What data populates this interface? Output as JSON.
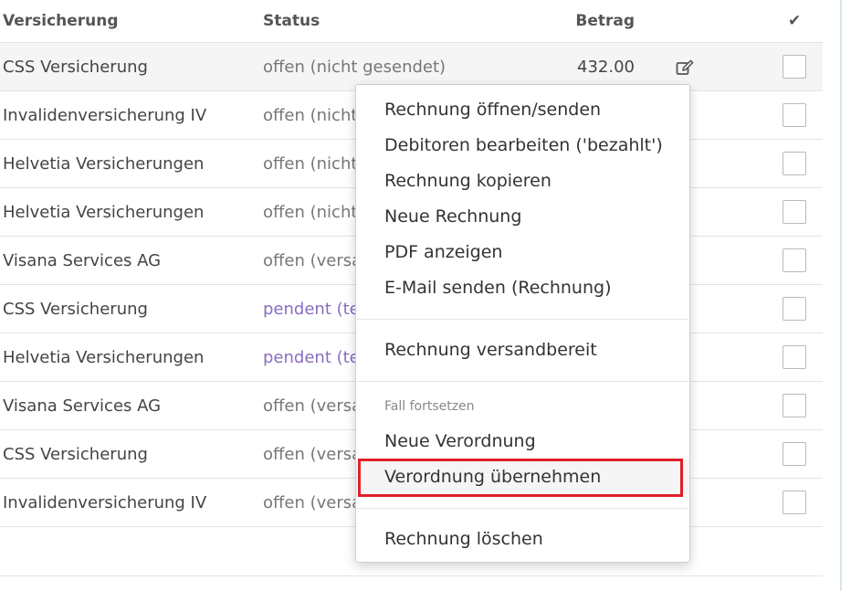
{
  "table": {
    "headers": {
      "insurance": "Versicherung",
      "status": "Status",
      "amount": "Betrag",
      "check": "✔"
    },
    "rows": [
      {
        "insurance": "CSS Versicherung",
        "status": "offen (nicht gesendet)",
        "status_kind": "open",
        "amount": "432.00"
      },
      {
        "insurance": "Invalidenversicherung IV",
        "status": "offen (nicht",
        "status_kind": "open",
        "amount": ""
      },
      {
        "insurance": "Helvetia Versicherungen",
        "status": "offen (nicht",
        "status_kind": "open",
        "amount": ""
      },
      {
        "insurance": "Helvetia Versicherungen",
        "status": "offen (nicht",
        "status_kind": "open",
        "amount": ""
      },
      {
        "insurance": "Visana Services AG",
        "status": "offen (versa",
        "status_kind": "open",
        "amount": ""
      },
      {
        "insurance": "CSS Versicherung",
        "status": "pendent (te",
        "status_kind": "pending",
        "amount": ""
      },
      {
        "insurance": "Helvetia Versicherungen",
        "status": "pendent (te",
        "status_kind": "pending",
        "amount": ""
      },
      {
        "insurance": "Visana Services AG",
        "status": "offen (versa",
        "status_kind": "open",
        "amount": ""
      },
      {
        "insurance": "CSS Versicherung",
        "status": "offen (versa",
        "status_kind": "open",
        "amount": ""
      },
      {
        "insurance": "Invalidenversicherung IV",
        "status": "offen (versa",
        "status_kind": "open",
        "amount": ""
      }
    ]
  },
  "context_menu": {
    "items": [
      "Rechnung öffnen/senden",
      "Debitoren bearbeiten ('bezahlt')",
      "Rechnung kopieren",
      "Neue Rechnung",
      "PDF anzeigen",
      "E-Mail senden (Rechnung)",
      "Rechnung versandbereit",
      "Neue Verordnung",
      "Verordnung übernehmen",
      "Rechnung löschen"
    ],
    "section_header": "Fall fortsetzen",
    "highlighted_item": "Verordnung übernehmen"
  },
  "colors": {
    "pending_status": "#8a6dc1",
    "highlight_border": "#e0202a",
    "edit_icon": "#555555"
  },
  "icons": {
    "row_action": "edit-icon",
    "header_check": "checkmark-icon"
  }
}
